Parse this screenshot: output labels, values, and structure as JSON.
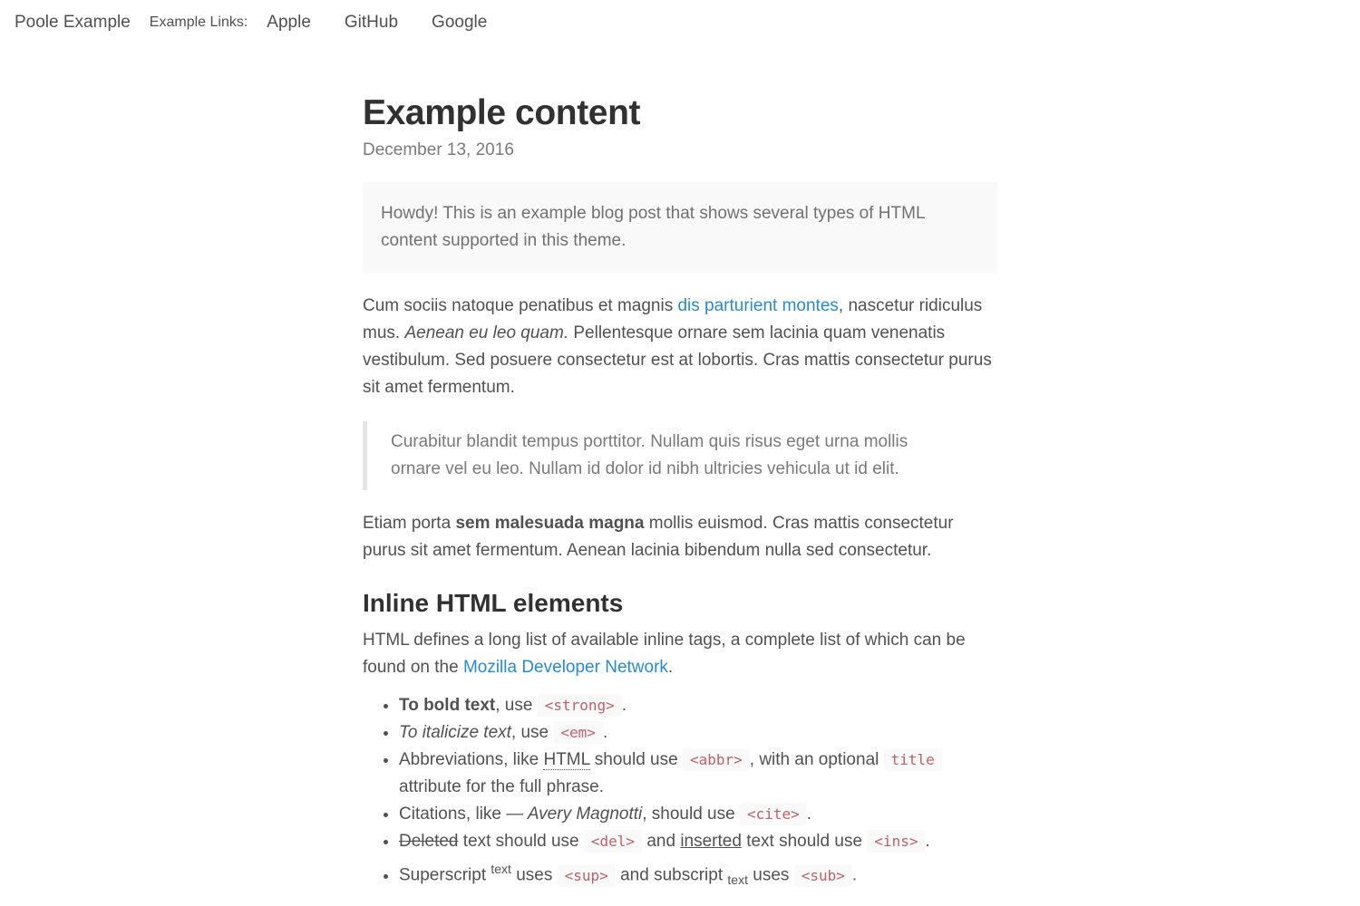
{
  "nav": {
    "site_title": "Poole Example",
    "links_label": "Example Links:",
    "links": [
      "Apple",
      "GitHub",
      "Google"
    ]
  },
  "post": {
    "title": "Example content",
    "date": "December 13, 2016",
    "message": "Howdy! This is an example blog post that shows several types of HTML content supported in this theme.",
    "p1": {
      "before_link": "Cum sociis natoque penatibus et magnis ",
      "link": "dis parturient montes",
      "after_link": ", nascetur ridiculus mus. ",
      "em": "Aenean eu leo quam.",
      "rest": " Pellentesque ornare sem lacinia quam venenatis vestibulum. Sed posuere consectetur est at lobortis. Cras mattis consectetur purus sit amet fermentum."
    },
    "blockquote": "Curabitur blandit tempus porttitor. Nullam quis risus eget urna mollis ornare vel eu leo. Nullam id dolor id nibh ultricies vehicula ut id elit.",
    "p2": {
      "before": "Etiam porta ",
      "strong": "sem malesuada magna",
      "after": " mollis euismod. Cras mattis consectetur purus sit amet fermentum. Aenean lacinia bibendum nulla sed consectetur."
    },
    "section_heading": "Inline HTML elements",
    "p3": {
      "before_link": "HTML defines a long list of available inline tags, a complete list of which can be found on the ",
      "link": "Mozilla Developer Network",
      "after_link": "."
    },
    "list": {
      "bold": {
        "strong": "To bold text",
        "mid": ", use ",
        "code": "<strong>",
        "end": "."
      },
      "italic": {
        "em": "To italicize text",
        "mid": ", use ",
        "code": "<em>",
        "end": "."
      },
      "abbr": {
        "before": "Abbreviations, like ",
        "abbr": "HTML",
        "mid": " should use ",
        "code1": "<abbr>",
        "mid2": ", with an optional ",
        "code2": "title",
        "end": " attribute for the full phrase."
      },
      "cite": {
        "before": "Citations, like ",
        "cite": "— Avery Magnotti",
        "mid": ", should use ",
        "code": "<cite>",
        "end": "."
      },
      "delins": {
        "del": "Deleted",
        "mid1": " text should use ",
        "code1": "<del>",
        "mid2": " and ",
        "ins": "inserted",
        "mid3": " text should use ",
        "code2": "<ins>",
        "end": "."
      },
      "supsub": {
        "before": "Superscript ",
        "sup": "text",
        "mid1": " uses ",
        "code1": "<sup>",
        "mid2": " and subscript ",
        "sub": "text",
        "mid3": " uses ",
        "code2": "<sub>",
        "end": "."
      }
    }
  },
  "colors": {
    "link": "#268bd2",
    "code": "#bf616a",
    "heading": "#313131",
    "text": "#515151"
  }
}
